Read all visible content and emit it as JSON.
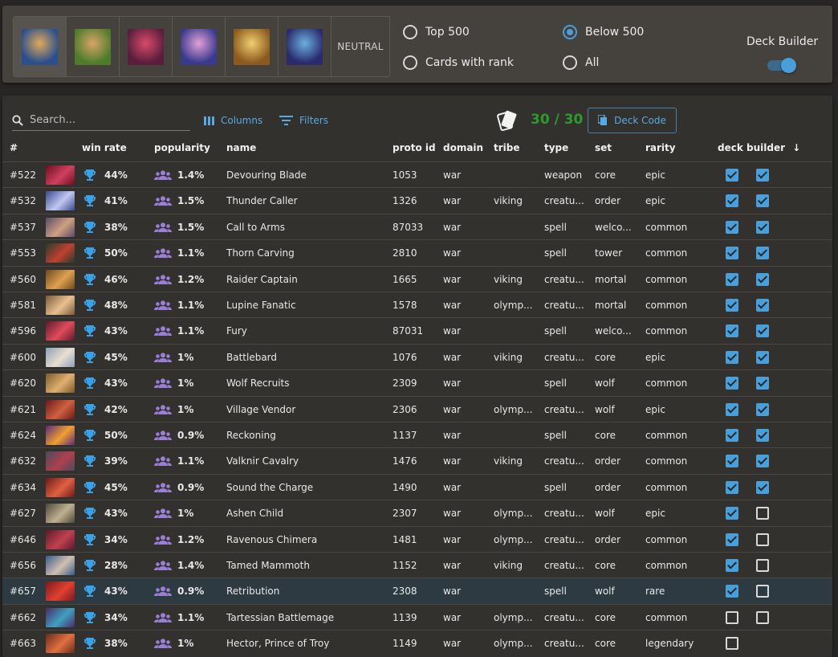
{
  "god_filter": {
    "gods": [
      {
        "name": "god-1",
        "c1": "#2b4f8c",
        "c2": "#e0a95a",
        "selected": true
      },
      {
        "name": "god-2",
        "c1": "#4f7c2c",
        "c2": "#d8a466",
        "selected": false
      },
      {
        "name": "god-3",
        "c1": "#5a1e3c",
        "c2": "#d94a6a",
        "selected": false
      },
      {
        "name": "god-4",
        "c1": "#3a3a8c",
        "c2": "#e0a0d8",
        "selected": false
      },
      {
        "name": "god-5",
        "c1": "#8c5a1e",
        "c2": "#f0d070",
        "selected": false
      },
      {
        "name": "god-6",
        "c1": "#2a2a6c",
        "c2": "#6ab0e0",
        "selected": false
      }
    ],
    "neutral_label": "NEUTRAL"
  },
  "rank_filter": {
    "top500": "Top 500",
    "below500": "Below 500",
    "with_rank": "Cards with rank",
    "all": "All",
    "selected": "below500"
  },
  "deck_builder": {
    "label": "Deck Builder",
    "enabled": true
  },
  "toolbar": {
    "search_placeholder": "Search...",
    "columns_label": "Columns",
    "filters_label": "Filters",
    "deck_count": "30 / 30",
    "deck_code_label": "Deck Code"
  },
  "columns": {
    "rank": "#",
    "win_rate": "win rate",
    "popularity": "popularity",
    "name": "name",
    "proto_id": "proto id",
    "domain": "domain",
    "tribe": "tribe",
    "type": "type",
    "set": "set",
    "rarity": "rarity",
    "deck_builder": "deck builder",
    "sort_arrow": "↓"
  },
  "colors": {
    "accent": "#4a9fd8",
    "deck_count": "#2e9a2e",
    "trophy": "#3aa0e8",
    "people": "#9b7fd6"
  },
  "rows": [
    {
      "rank": "#522",
      "win_rate": "44%",
      "popularity": "1.4%",
      "name": "Devouring Blade",
      "proto_id": "1053",
      "domain": "war",
      "tribe": "",
      "type": "weapon",
      "set": "core",
      "rarity": "epic",
      "c1": true,
      "c2": true,
      "t1": "#6a1020",
      "t2": "#d04060"
    },
    {
      "rank": "#532",
      "win_rate": "41%",
      "popularity": "1.5%",
      "name": "Thunder Caller",
      "proto_id": "1326",
      "domain": "war",
      "tribe": "viking",
      "type": "creatu...",
      "set": "order",
      "rarity": "epic",
      "c1": true,
      "c2": true,
      "t1": "#3a4a8c",
      "t2": "#c0c8f0"
    },
    {
      "rank": "#537",
      "win_rate": "38%",
      "popularity": "1.5%",
      "name": "Call to Arms",
      "proto_id": "87033",
      "domain": "war",
      "tribe": "",
      "type": "spell",
      "set": "welco...",
      "rarity": "common",
      "c1": true,
      "c2": true,
      "t1": "#5a4a6a",
      "t2": "#d0a080"
    },
    {
      "rank": "#553",
      "win_rate": "50%",
      "popularity": "1.1%",
      "name": "Thorn Carving",
      "proto_id": "2810",
      "domain": "war",
      "tribe": "",
      "type": "spell",
      "set": "tower",
      "rarity": "common",
      "c1": true,
      "c2": true,
      "t1": "#2a3a2a",
      "t2": "#c04030"
    },
    {
      "rank": "#560",
      "win_rate": "46%",
      "popularity": "1.2%",
      "name": "Raider Captain",
      "proto_id": "1665",
      "domain": "war",
      "tribe": "viking",
      "type": "creatu...",
      "set": "mortal",
      "rarity": "common",
      "c1": true,
      "c2": true,
      "t1": "#6a4a1e",
      "t2": "#e0a050"
    },
    {
      "rank": "#581",
      "win_rate": "48%",
      "popularity": "1.1%",
      "name": "Lupine Fanatic",
      "proto_id": "1578",
      "domain": "war",
      "tribe": "olymp...",
      "type": "creatu...",
      "set": "mortal",
      "rarity": "common",
      "c1": true,
      "c2": true,
      "t1": "#7a5a3a",
      "t2": "#e8c090"
    },
    {
      "rank": "#596",
      "win_rate": "43%",
      "popularity": "1.1%",
      "name": "Fury",
      "proto_id": "87031",
      "domain": "war",
      "tribe": "",
      "type": "spell",
      "set": "welco...",
      "rarity": "common",
      "c1": true,
      "c2": true,
      "t1": "#5a1a2a",
      "t2": "#e04a5a"
    },
    {
      "rank": "#600",
      "win_rate": "45%",
      "popularity": "1%",
      "name": "Battlebard",
      "proto_id": "1076",
      "domain": "war",
      "tribe": "viking",
      "type": "creatu...",
      "set": "core",
      "rarity": "epic",
      "c1": true,
      "c2": true,
      "t1": "#8aa0b8",
      "t2": "#e8e0d0"
    },
    {
      "rank": "#620",
      "win_rate": "43%",
      "popularity": "1%",
      "name": "Wolf Recruits",
      "proto_id": "2309",
      "domain": "war",
      "tribe": "",
      "type": "spell",
      "set": "wolf",
      "rarity": "common",
      "c1": true,
      "c2": true,
      "t1": "#7a5a2a",
      "t2": "#e0b070"
    },
    {
      "rank": "#621",
      "win_rate": "42%",
      "popularity": "1%",
      "name": "Village Vendor",
      "proto_id": "2306",
      "domain": "war",
      "tribe": "olymp...",
      "type": "creatu...",
      "set": "wolf",
      "rarity": "epic",
      "c1": true,
      "c2": true,
      "t1": "#6a1a1a",
      "t2": "#d06040"
    },
    {
      "rank": "#624",
      "win_rate": "50%",
      "popularity": "0.9%",
      "name": "Reckoning",
      "proto_id": "1137",
      "domain": "war",
      "tribe": "",
      "type": "spell",
      "set": "core",
      "rarity": "common",
      "c1": true,
      "c2": true,
      "t1": "#5a2a7a",
      "t2": "#f0a030"
    },
    {
      "rank": "#632",
      "win_rate": "39%",
      "popularity": "1.1%",
      "name": "Valknir Cavalry",
      "proto_id": "1476",
      "domain": "war",
      "tribe": "viking",
      "type": "creatu...",
      "set": "order",
      "rarity": "common",
      "c1": true,
      "c2": true,
      "t1": "#4a4a5a",
      "t2": "#b04050"
    },
    {
      "rank": "#634",
      "win_rate": "45%",
      "popularity": "0.9%",
      "name": "Sound the Charge",
      "proto_id": "1490",
      "domain": "war",
      "tribe": "",
      "type": "spell",
      "set": "order",
      "rarity": "common",
      "c1": true,
      "c2": true,
      "t1": "#6a1a1a",
      "t2": "#e06040"
    },
    {
      "rank": "#627",
      "win_rate": "43%",
      "popularity": "1%",
      "name": "Ashen Child",
      "proto_id": "2307",
      "domain": "war",
      "tribe": "olymp...",
      "type": "creatu...",
      "set": "wolf",
      "rarity": "epic",
      "c1": true,
      "c2": false,
      "t1": "#4a4a3a",
      "t2": "#c0b090"
    },
    {
      "rank": "#646",
      "win_rate": "34%",
      "popularity": "1.2%",
      "name": "Ravenous Chimera",
      "proto_id": "1481",
      "domain": "war",
      "tribe": "olymp...",
      "type": "creatu...",
      "set": "order",
      "rarity": "common",
      "c1": true,
      "c2": false,
      "t1": "#5a1a2a",
      "t2": "#c04050"
    },
    {
      "rank": "#656",
      "win_rate": "28%",
      "popularity": "1.4%",
      "name": "Tamed Mammoth",
      "proto_id": "1152",
      "domain": "war",
      "tribe": "viking",
      "type": "creatu...",
      "set": "core",
      "rarity": "common",
      "c1": true,
      "c2": false,
      "t1": "#3a5a8a",
      "t2": "#d0c0b0"
    },
    {
      "rank": "#657",
      "win_rate": "43%",
      "popularity": "0.9%",
      "name": "Retribution",
      "proto_id": "2308",
      "domain": "war",
      "tribe": "",
      "type": "spell",
      "set": "wolf",
      "rarity": "rare",
      "c1": true,
      "c2": false,
      "t1": "#7a1a1a",
      "t2": "#e04030",
      "highlight": true
    },
    {
      "rank": "#662",
      "win_rate": "34%",
      "popularity": "1.1%",
      "name": "Tartessian Battlemage",
      "proto_id": "1139",
      "domain": "war",
      "tribe": "olymp...",
      "type": "creatu...",
      "set": "core",
      "rarity": "common",
      "c1": false,
      "c2": false,
      "t1": "#4a2a6a",
      "t2": "#40a0c0"
    },
    {
      "rank": "#663",
      "win_rate": "38%",
      "popularity": "1%",
      "name": "Hector, Prince of Troy",
      "proto_id": "1149",
      "domain": "war",
      "tribe": "olymp...",
      "type": "creatu...",
      "set": "core",
      "rarity": "legendary",
      "c1": false,
      "c2": null,
      "t1": "#6a2a1a",
      "t2": "#e07040"
    }
  ]
}
